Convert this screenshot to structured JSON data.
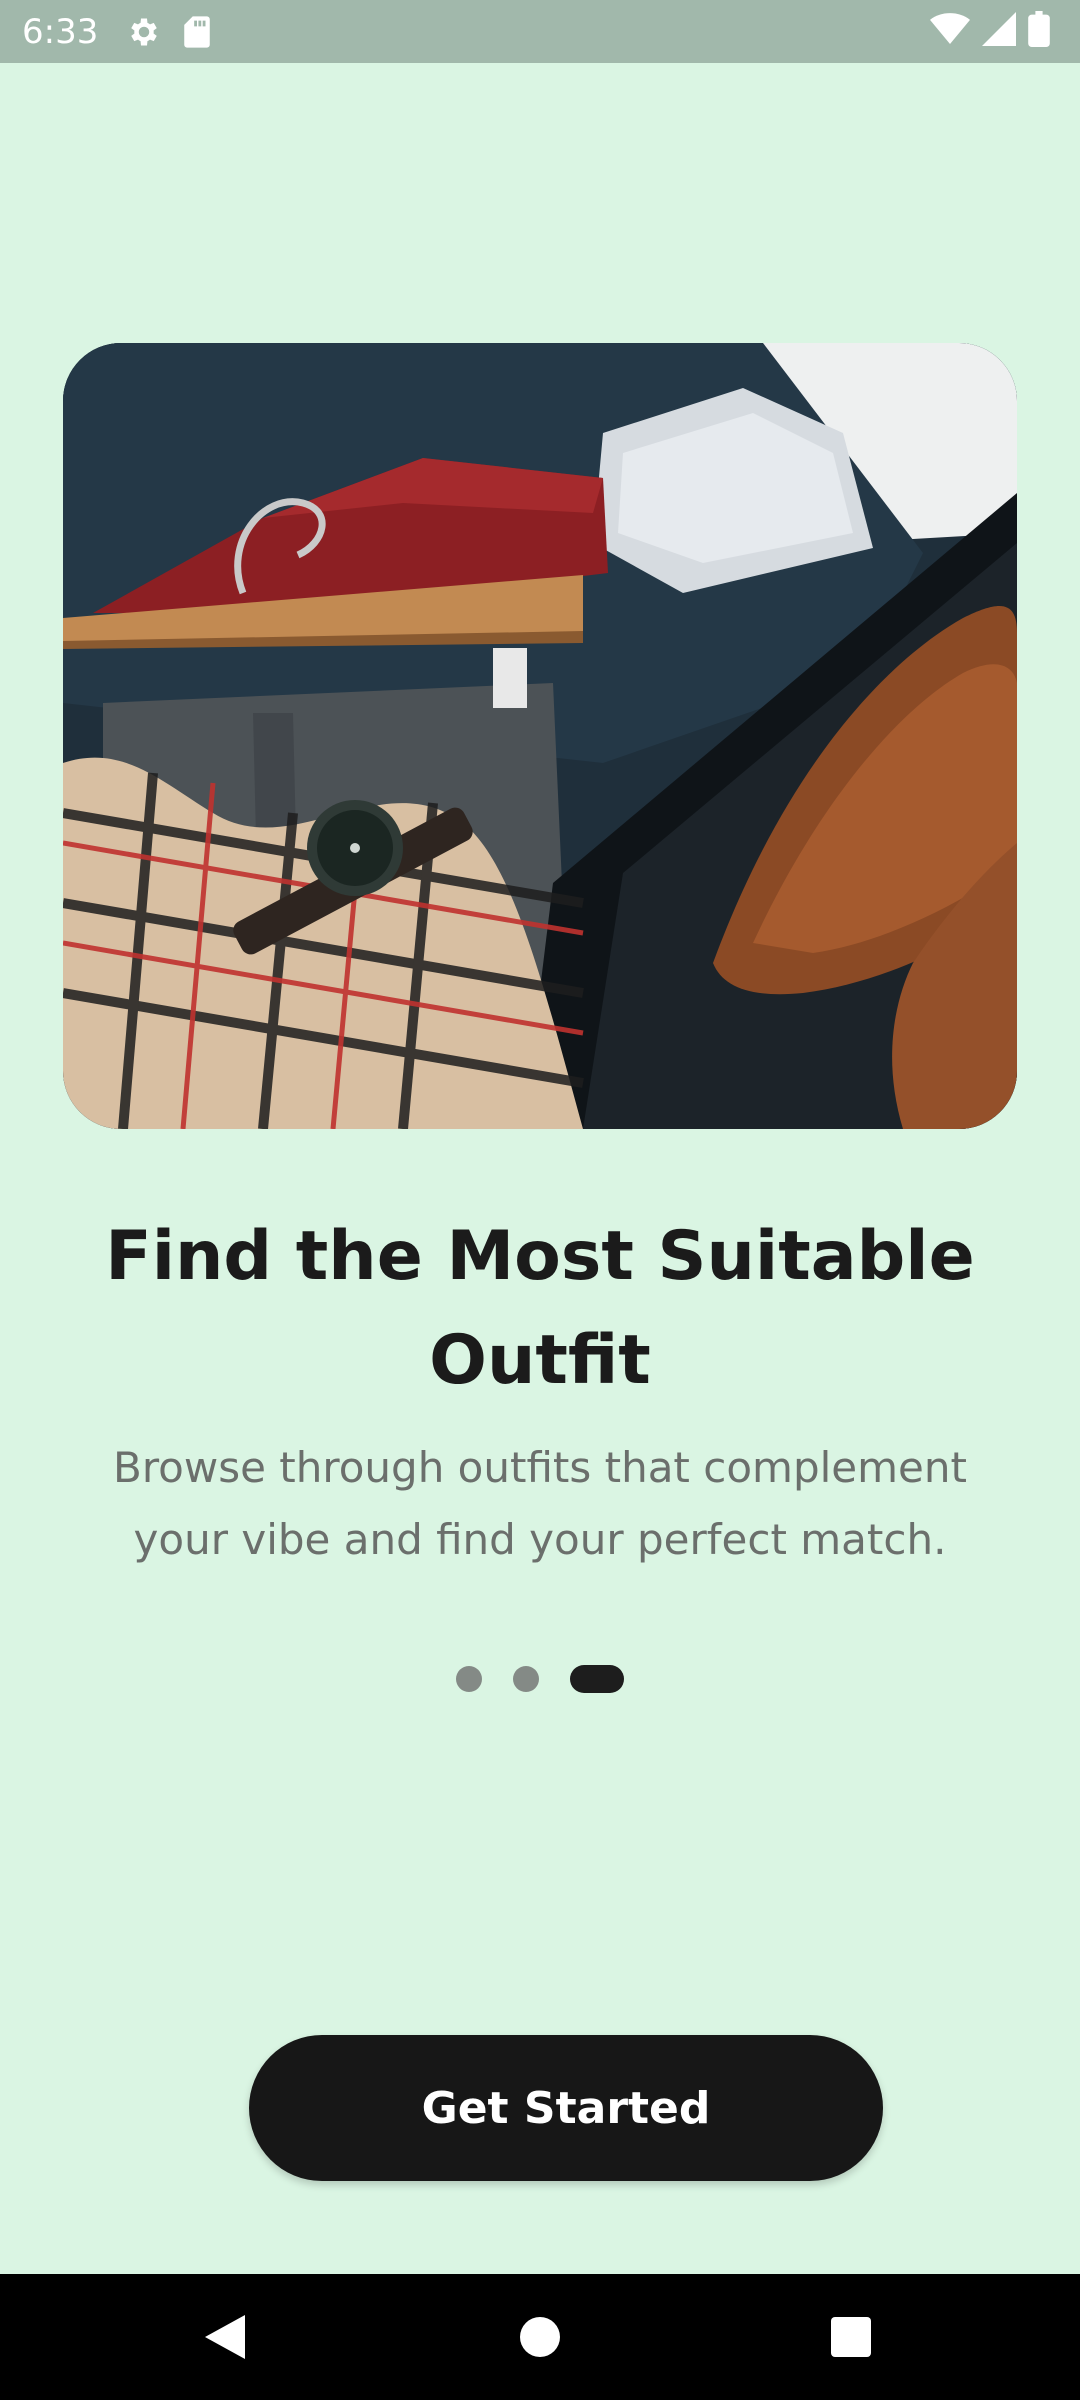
{
  "status_bar": {
    "time": "6:33",
    "icons": [
      "gear-icon",
      "sd-card-icon",
      "wifi-icon",
      "signal-icon",
      "battery-icon"
    ]
  },
  "hero": {
    "icon": "outfit-photo"
  },
  "onboarding": {
    "title": "Find the Most Suitable Outfit",
    "subtitle": "Browse through outfits that complement your vibe and find your perfect match.",
    "page_count": 3,
    "active_page": 3
  },
  "cta": {
    "label": "Get Started"
  },
  "nav_bar": {
    "icons": [
      "back-icon",
      "home-icon",
      "recents-icon"
    ]
  },
  "colors": {
    "background": "#daf5e3",
    "status_bar": "#a1b8ab",
    "title": "#1b1b1b",
    "subtitle": "#6b6f6c",
    "button": "#171717",
    "dot_inactive": "#848a86",
    "dot_active": "#1d1d1d"
  }
}
